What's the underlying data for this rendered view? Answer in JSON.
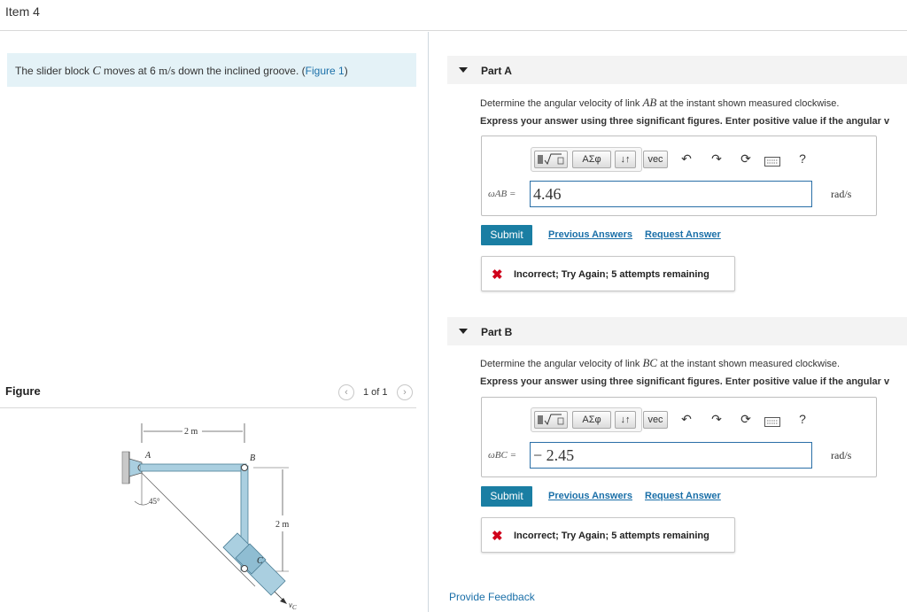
{
  "item_title": "Item 4",
  "problem": {
    "text_before": "The slider block ",
    "var_c": "C",
    "text_moves": " moves at 6 ",
    "unit": "m/s",
    "text_after": " down the inclined groove. (",
    "figure_link": "Figure 1",
    "text_close": ")"
  },
  "figure": {
    "label": "Figure",
    "pager": "1 of 1",
    "prev_icon": "‹",
    "next_icon": "›",
    "labels": {
      "dim_top": "2 m",
      "dim_right": "2 m",
      "a": "A",
      "b": "B",
      "c": "C",
      "angle": "45°",
      "vc": "v",
      "vc_sub": "C"
    }
  },
  "toolbar": {
    "templates_icon": "radical-template-icon",
    "greek": "ΑΣφ",
    "sort": "↓↑",
    "vec": "vec",
    "undo_icon": "undo-icon",
    "redo_icon": "redo-icon",
    "reset_icon": "reset-icon",
    "keyboard_icon": "keyboard-icon",
    "help": "?"
  },
  "parts": [
    {
      "label": "Part A",
      "q_before": "Determine the angular velocity of link ",
      "q_var": "AB",
      "q_after": " at the instant shown measured clockwise.",
      "instruction": "Express your answer using three significant figures. Enter positive value if the angular v",
      "var_label": "ωAB =",
      "answer": "4.46",
      "unit": "rad/s",
      "submit": "Submit",
      "previous": "Previous Answers",
      "request": "Request Answer",
      "feedback": "Incorrect; Try Again; 5 attempts remaining"
    },
    {
      "label": "Part B",
      "q_before": "Determine the angular velocity of link ",
      "q_var": "BC",
      "q_after": " at the instant shown measured clockwise.",
      "instruction": "Express your answer using three significant figures. Enter positive value if the angular v",
      "var_label": "ωBC =",
      "answer": "− 2.45",
      "unit": "rad/s",
      "submit": "Submit",
      "previous": "Previous Answers",
      "request": "Request Answer",
      "feedback": "Incorrect; Try Again; 5 attempts remaining"
    }
  ],
  "provide_feedback": "Provide Feedback"
}
